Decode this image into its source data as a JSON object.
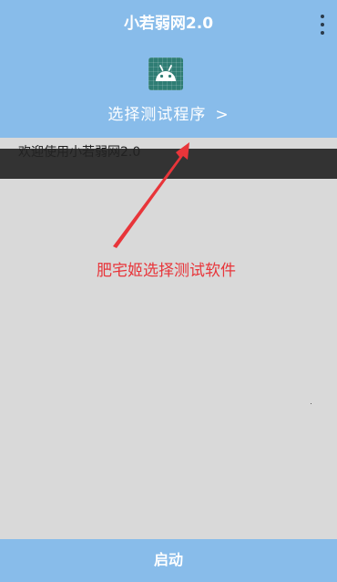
{
  "app": {
    "title": "小若弱网2.0",
    "menu_icon": "more-vert-icon"
  },
  "picker": {
    "icon": "android-icon",
    "label": "选择测试程序",
    "chevron": ">"
  },
  "log": {
    "message": "欢迎使用小若弱网2.0"
  },
  "annotation": {
    "text": "肥宅姬选择测试软件",
    "color": "#e8353a"
  },
  "bottom": {
    "start_label": "启动"
  },
  "colors": {
    "accent": "#88bcea",
    "background": "#d9d9d9",
    "log_bar": "#333333",
    "icon_bg": "#2f7d74"
  }
}
